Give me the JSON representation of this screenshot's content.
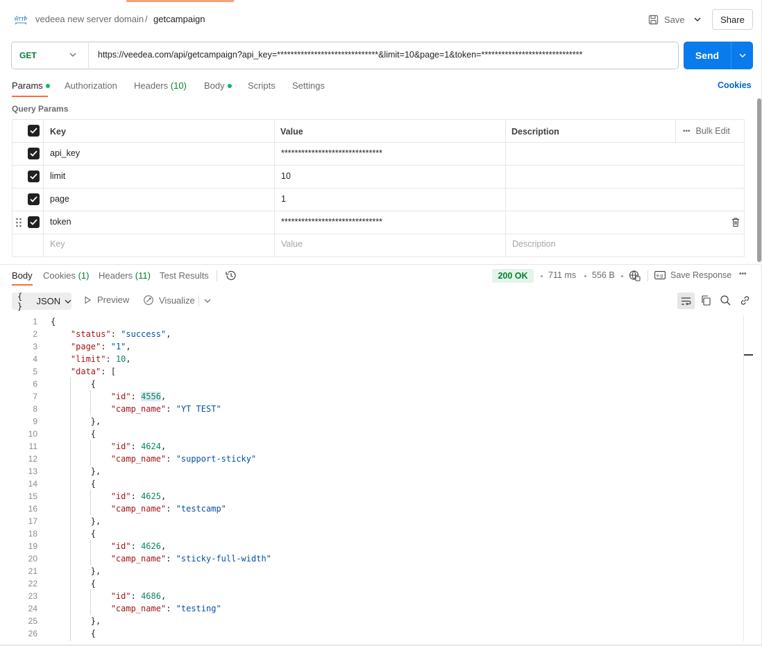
{
  "header": {
    "breadcrumb_parent": "vedeea new server domain",
    "breadcrumb_sep": "/",
    "breadcrumb_current": "getcampaign",
    "save_label": "Save",
    "share_label": "Share"
  },
  "request": {
    "method": "GET",
    "url": "https://veedea.com/api/getcampaign?api_key=******************************&limit=10&page=1&token=******************************",
    "send_label": "Send"
  },
  "request_tabs": {
    "params": "Params",
    "authorization": "Authorization",
    "headers": "Headers",
    "headers_count": "(10)",
    "body": "Body",
    "scripts": "Scripts",
    "settings": "Settings",
    "cookies": "Cookies"
  },
  "query_params": {
    "title": "Query Params",
    "columns": {
      "key": "Key",
      "value": "Value",
      "description": "Description"
    },
    "bulk_edit": "Bulk Edit",
    "rows": [
      {
        "key": "api_key",
        "value": "******************************",
        "description": ""
      },
      {
        "key": "limit",
        "value": "10",
        "description": ""
      },
      {
        "key": "page",
        "value": "1",
        "description": ""
      },
      {
        "key": "token",
        "value": "******************************",
        "description": ""
      }
    ],
    "placeholders": {
      "key": "Key",
      "value": "Value",
      "description": "Description"
    }
  },
  "response_tabs": {
    "body": "Body",
    "cookies": "Cookies",
    "cookies_count": "(1)",
    "headers": "Headers",
    "headers_count": "(11)",
    "test_results": "Test Results"
  },
  "response_meta": {
    "status": "200 OK",
    "time": "711 ms",
    "size": "556 B",
    "save_response": "Save Response"
  },
  "response_toolbar": {
    "format": "JSON",
    "preview": "Preview",
    "visualize": "Visualize"
  },
  "code_lines": [
    "1",
    "2",
    "3",
    "4",
    "5",
    "6",
    "7",
    "8",
    "9",
    "10",
    "11",
    "12",
    "13",
    "14",
    "15",
    "16",
    "17",
    "18",
    "19",
    "20",
    "21",
    "22",
    "23",
    "24",
    "25",
    "26"
  ],
  "response_json": {
    "status_key": "\"status\"",
    "status_val": "\"success\"",
    "page_key": "\"page\"",
    "page_val": "\"1\"",
    "limit_key": "\"limit\"",
    "limit_val": "10",
    "data_key": "\"data\"",
    "id_key": "\"id\"",
    "camp_key": "\"camp_name\"",
    "items": [
      {
        "id": "4556",
        "camp_name": "\"YT TEST\""
      },
      {
        "id": "4624",
        "camp_name": "\"support-sticky\""
      },
      {
        "id": "4625",
        "camp_name": "\"testcamp\""
      },
      {
        "id": "4626",
        "camp_name": "\"sticky-full-width\""
      },
      {
        "id": "4686",
        "camp_name": "\"testing\""
      }
    ]
  },
  "colors": {
    "accent": "#ff6c37",
    "send": "#097bed",
    "success": "#007f31",
    "json_key": "#a31515",
    "json_string": "#0451a5",
    "json_number": "#098658"
  }
}
